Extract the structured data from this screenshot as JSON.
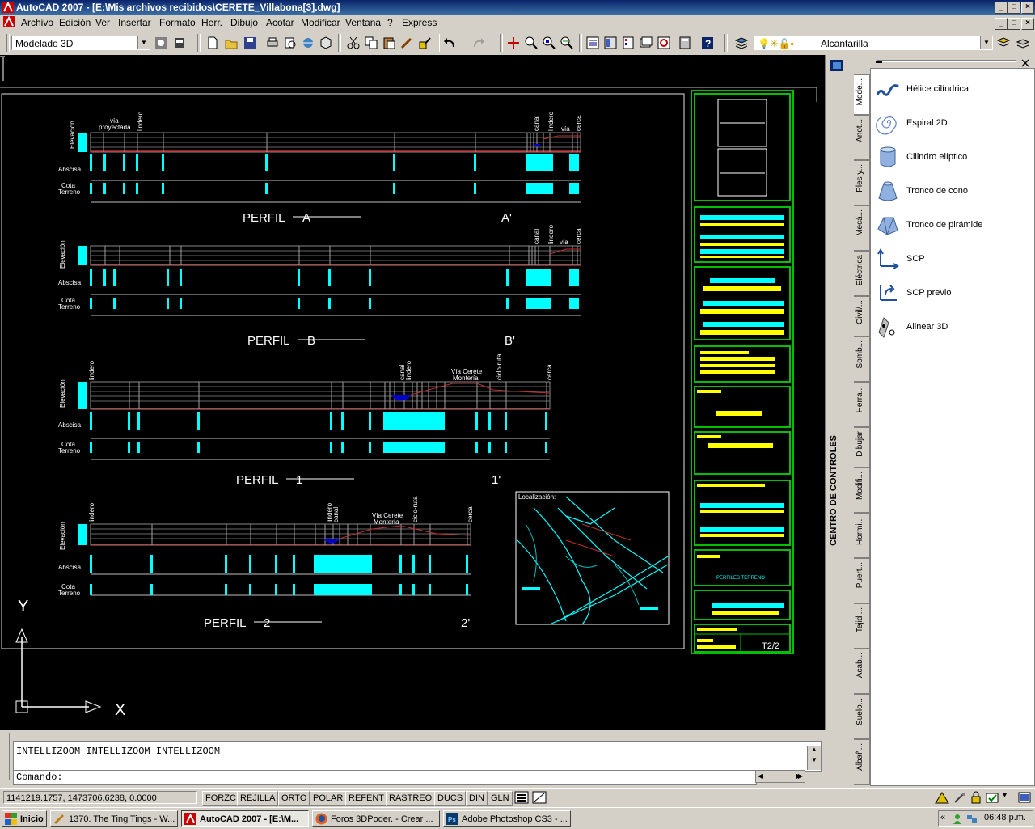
{
  "window": {
    "title": "AutoCAD 2007 - [E:\\Mis archivos recibidos\\CERETE_Villabona[3].dwg]"
  },
  "menu": [
    "Archivo",
    "Edición",
    "Ver",
    "Insertar",
    "Formato",
    "Herr.",
    "Dibujo",
    "Acotar",
    "Modificar",
    "Ventana",
    "?",
    "Express"
  ],
  "toolbar": {
    "workspace": "Modelado 3D",
    "layer": "Alcantarilla"
  },
  "drawing": {
    "perfiles": [
      {
        "title": "PERFIL",
        "a": "A",
        "b": "A'"
      },
      {
        "title": "PERFIL",
        "a": "B",
        "b": "B'"
      },
      {
        "title": "PERFIL",
        "a": "1",
        "b": "1'"
      },
      {
        "title": "PERFIL",
        "a": "2",
        "b": "2'"
      }
    ],
    "row_labels": {
      "elevacion": "Elevación",
      "abscisa": "Abscisa",
      "cota": "Cota",
      "terreno": "Terreno"
    },
    "annotations": {
      "via": "vía",
      "proyectada": "proyectada",
      "lindero": "lindero",
      "canal": "canal",
      "via2": "vía",
      "cerca": "cerca",
      "via_cerete": "Vía Cerete",
      "monteria": "Montería",
      "ciclo_ruta": "ciclo-ruta"
    },
    "localizacion": "Localización:",
    "sheet": "T2/2",
    "perfiles_terreno": "PERFILES TERRENO",
    "ucs_x": "X",
    "ucs_y": "Y"
  },
  "control_center": {
    "label": "CENTRO DE CONTROLES"
  },
  "palette": {
    "tabs": [
      "Mode...",
      "Anot...",
      "Ples y...",
      "Mecá...",
      "Eléctrica",
      "Civil/...",
      "Somb...",
      "Herra...",
      "Dibujar",
      "Modifi...",
      "Hormi...",
      "Puert...",
      "Tejidi...",
      "Acab...",
      "Suelo...",
      "Albañ..."
    ],
    "tools": [
      "Hélice cilíndrica",
      "Espiral 2D",
      "Cilindro elíptico",
      "Tronco de cono",
      "Tronco de pirámide",
      "SCP",
      "SCP previo",
      "Alinear 3D"
    ]
  },
  "command": {
    "history": "INTELLIZOOM INTELLIZOOM INTELLIZOOM",
    "prompt": "Comando:"
  },
  "status": {
    "coords": "1141219.1757, 1473706.6238, 0.0000",
    "buttons": [
      "FORZC",
      "REJILLA",
      "ORTO",
      "POLAR",
      "REFENT",
      "RASTREO",
      "DUCS",
      "DIN",
      "GLN"
    ]
  },
  "taskbar": {
    "start": "Inicio",
    "tasks": [
      "1370. The Ting Tings - W...",
      "AutoCAD 2007 - [E:\\M...",
      "Foros 3DPoder. - Crear ...",
      "Adobe Photoshop CS3 - ..."
    ],
    "clock": "06:48 p.m."
  },
  "colors": {
    "bg": "#000000",
    "profile_red": "#c03030",
    "cyan": "#00ffff",
    "yellow": "#ffff00",
    "green": "#00c000"
  }
}
